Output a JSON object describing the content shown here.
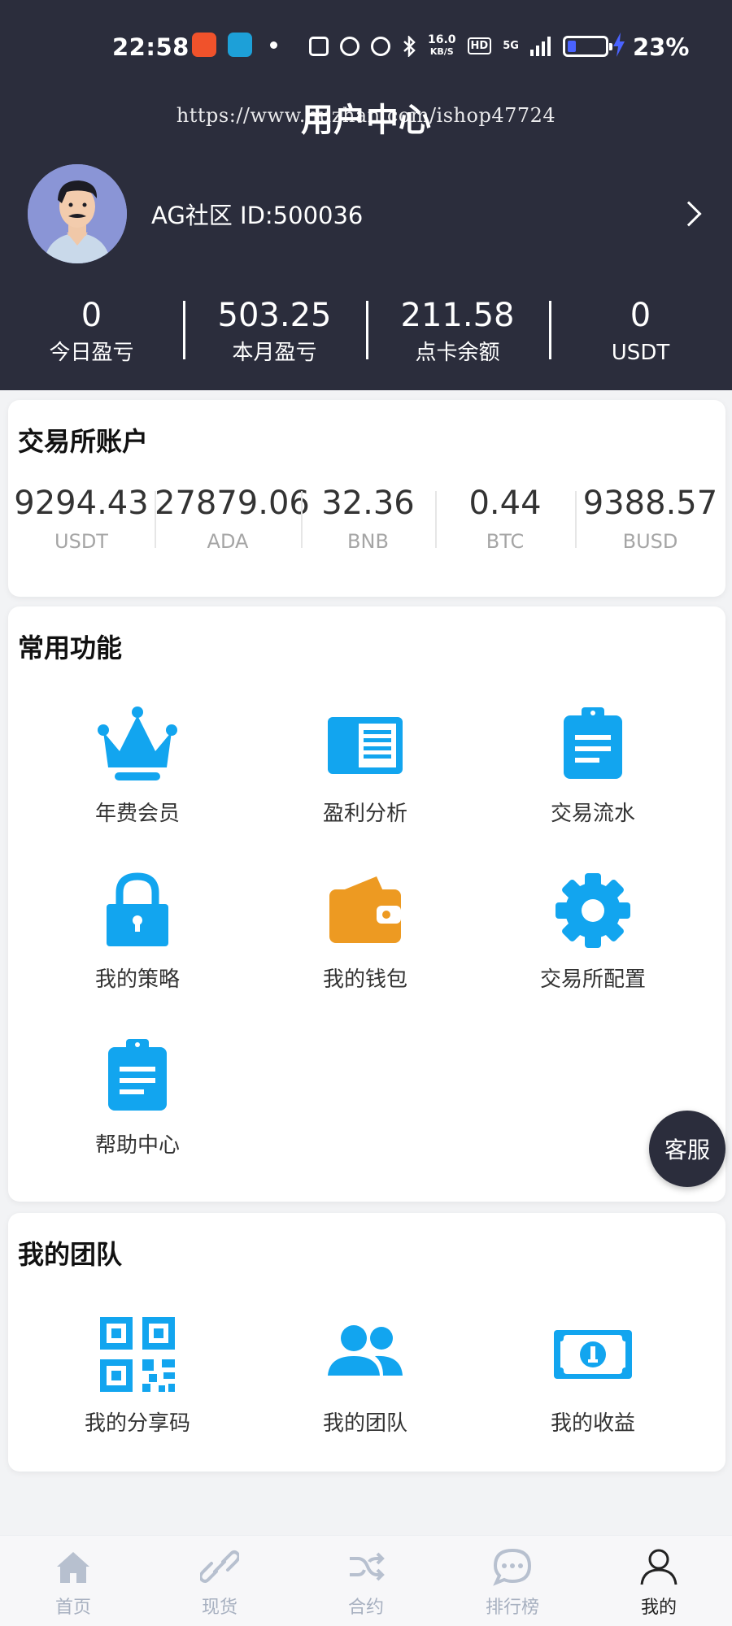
{
  "status_bar": {
    "time": "22:58",
    "net_speed": "16.0",
    "net_speed_unit": "KB/S",
    "hd": "HD",
    "network": "5G",
    "battery_percent_text": "23%",
    "battery_level": 0.23
  },
  "header": {
    "title": "用户中心",
    "watermark": "https://www.huzhan.com/ishop47724",
    "user_label": "AG社区 ID:500036"
  },
  "stats": [
    {
      "value": "0",
      "label": "今日盈亏"
    },
    {
      "value": "503.25",
      "label": "本月盈亏"
    },
    {
      "value": "211.58",
      "label": "点卡余额"
    },
    {
      "value": "0",
      "label": "USDT"
    }
  ],
  "exchange": {
    "title": "交易所账户",
    "balances": [
      {
        "value": "9294.43",
        "unit": "USDT"
      },
      {
        "value": "27879.06",
        "unit": "ADA"
      },
      {
        "value": "32.36",
        "unit": "BNB"
      },
      {
        "value": "0.44",
        "unit": "BTC"
      },
      {
        "value": "9388.57",
        "unit": "BUSD"
      }
    ]
  },
  "functions": {
    "title": "常用功能",
    "items": [
      {
        "label": "年费会员",
        "icon": "crown-icon"
      },
      {
        "label": "盈利分析",
        "icon": "book-icon"
      },
      {
        "label": "交易流水",
        "icon": "clipboard-icon"
      },
      {
        "label": "我的策略",
        "icon": "lock-icon"
      },
      {
        "label": "我的钱包",
        "icon": "wallet-icon"
      },
      {
        "label": "交易所配置",
        "icon": "gear-icon"
      },
      {
        "label": "帮助中心",
        "icon": "clipboard-icon"
      }
    ]
  },
  "team": {
    "title": "我的团队",
    "items": [
      {
        "label": "我的分享码",
        "icon": "qr-code-icon"
      },
      {
        "label": "我的团队",
        "icon": "users-icon"
      },
      {
        "label": "我的收益",
        "icon": "money-icon"
      }
    ]
  },
  "service_button": "客服",
  "bottom_nav": [
    {
      "label": "首页",
      "icon": "home-icon",
      "active": false
    },
    {
      "label": "现货",
      "icon": "link-icon",
      "active": false
    },
    {
      "label": "合约",
      "icon": "shuffle-icon",
      "active": false
    },
    {
      "label": "排行榜",
      "icon": "chat-icon",
      "active": false
    },
    {
      "label": "我的",
      "icon": "user-icon",
      "active": true
    }
  ],
  "colors": {
    "header_bg": "#2b2d3c",
    "icon_blue": "#12a5ef",
    "wallet_orange": "#ed9a22",
    "page_bg": "#f2f3f5"
  }
}
